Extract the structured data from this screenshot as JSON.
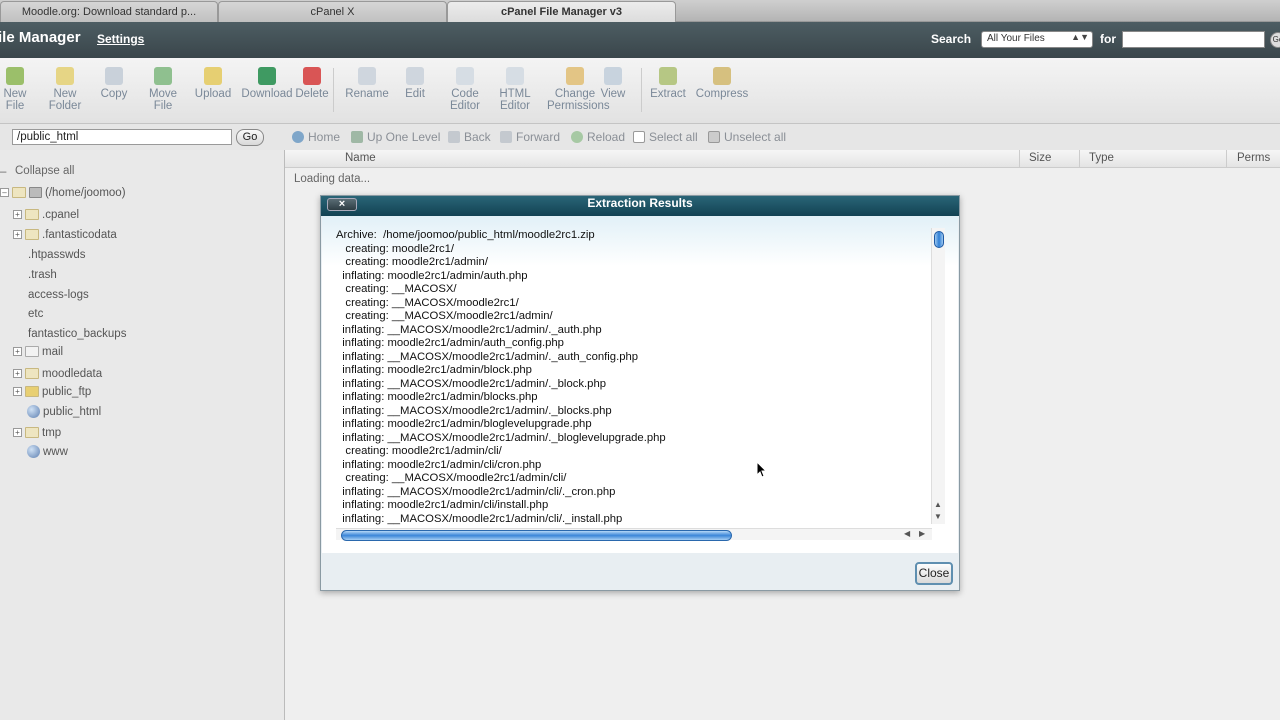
{
  "browser": {
    "tabs": [
      {
        "label": "Moodle.org: Download standard p..."
      },
      {
        "label": "cPanel X"
      },
      {
        "label": "cPanel File Manager v3"
      }
    ]
  },
  "header": {
    "title": "ile Manager",
    "settings_label": "Settings",
    "search_label": "Search",
    "scope_value": "All Your Files",
    "for_label": "for",
    "search_value": "",
    "search_go_label": "Go"
  },
  "toolbar": {
    "items": [
      {
        "label": "New\nFile",
        "icon": "new-file-icon",
        "color": "#9bbf6a"
      },
      {
        "label": "New\nFolder",
        "icon": "new-folder-icon",
        "color": "#e6d585"
      },
      {
        "label": "Copy",
        "icon": "copy-icon",
        "color": "#c9d1da"
      },
      {
        "label": "Move\nFile",
        "icon": "move-file-icon",
        "color": "#8fc08f"
      },
      {
        "label": "Upload",
        "icon": "upload-icon",
        "color": "#e6cf72"
      },
      {
        "label": "Download",
        "icon": "download-icon",
        "color": "#3f9a62"
      },
      {
        "label": "Delete",
        "icon": "delete-icon",
        "color": "#d95555"
      },
      {
        "label": "Rename",
        "icon": "rename-icon",
        "color": "#cfd6de"
      },
      {
        "label": "Edit",
        "icon": "edit-icon",
        "color": "#cfd6de"
      },
      {
        "label": "Code\nEditor",
        "icon": "code-editor-icon",
        "color": "#d6dde4"
      },
      {
        "label": "HTML\nEditor",
        "icon": "html-editor-icon",
        "color": "#d6dde4"
      },
      {
        "label": "Change\nPermissions",
        "icon": "permissions-key-icon",
        "color": "#e3c585"
      },
      {
        "label": "View",
        "icon": "view-magnifier-icon",
        "color": "#c8d3de"
      },
      {
        "label": "Extract",
        "icon": "extract-icon",
        "color": "#b6c784"
      },
      {
        "label": "Compress",
        "icon": "compress-icon",
        "color": "#d6c07f"
      }
    ]
  },
  "pathbar": {
    "path": "/public_html",
    "go_label": "Go"
  },
  "nav": {
    "home": "Home",
    "up": "Up One Level",
    "back": "Back",
    "forward": "Forward",
    "reload": "Reload",
    "select_all": "Select all",
    "unselect_all": "Unselect all"
  },
  "sidebar": {
    "collapse_label": "Collapse all",
    "root_label": "(/home/joomoo)",
    "items": [
      {
        "label": ".cpanel",
        "icon": "folder-icon",
        "expandable": true
      },
      {
        "label": ".fantasticodata",
        "icon": "folder-icon",
        "expandable": true
      },
      {
        "label": ".htpasswds",
        "icon": "",
        "expandable": false
      },
      {
        "label": ".trash",
        "icon": "",
        "expandable": false
      },
      {
        "label": "access-logs",
        "icon": "",
        "expandable": false
      },
      {
        "label": "etc",
        "icon": "",
        "expandable": false
      },
      {
        "label": "fantastico_backups",
        "icon": "",
        "expandable": false
      },
      {
        "label": "mail",
        "icon": "mail-folder-icon",
        "expandable": true
      },
      {
        "label": "moodledata",
        "icon": "folder-icon",
        "expandable": true
      },
      {
        "label": "public_ftp",
        "icon": "ftp-folder-icon",
        "expandable": true
      },
      {
        "label": "public_html",
        "icon": "globe-icon",
        "expandable": false
      },
      {
        "label": "tmp",
        "icon": "folder-icon",
        "expandable": true
      },
      {
        "label": "www",
        "icon": "globe-icon",
        "expandable": false
      }
    ]
  },
  "filelist": {
    "columns": [
      "Name",
      "Size",
      "Type",
      "Perms"
    ],
    "status": "Loading data..."
  },
  "dialog": {
    "title": "Extraction Results",
    "close_x_label": "×",
    "close_label": "Close",
    "lines": [
      "Archive:  /home/joomoo/public_html/moodle2rc1.zip",
      "   creating: moodle2rc1/",
      "   creating: moodle2rc1/admin/",
      "  inflating: moodle2rc1/admin/auth.php",
      "   creating: __MACOSX/",
      "   creating: __MACOSX/moodle2rc1/",
      "   creating: __MACOSX/moodle2rc1/admin/",
      "  inflating: __MACOSX/moodle2rc1/admin/._auth.php",
      "  inflating: moodle2rc1/admin/auth_config.php",
      "  inflating: __MACOSX/moodle2rc1/admin/._auth_config.php",
      "  inflating: moodle2rc1/admin/block.php",
      "  inflating: __MACOSX/moodle2rc1/admin/._block.php",
      "  inflating: moodle2rc1/admin/blocks.php",
      "  inflating: __MACOSX/moodle2rc1/admin/._blocks.php",
      "  inflating: moodle2rc1/admin/bloglevelupgrade.php",
      "  inflating: __MACOSX/moodle2rc1/admin/._bloglevelupgrade.php",
      "   creating: moodle2rc1/admin/cli/",
      "  inflating: moodle2rc1/admin/cli/cron.php",
      "   creating: __MACOSX/moodle2rc1/admin/cli/",
      "  inflating: __MACOSX/moodle2rc1/admin/cli/._cron.php",
      "  inflating: moodle2rc1/admin/cli/install.php",
      "  inflating: __MACOSX/moodle2rc1/admin/cli/._install.php"
    ]
  }
}
